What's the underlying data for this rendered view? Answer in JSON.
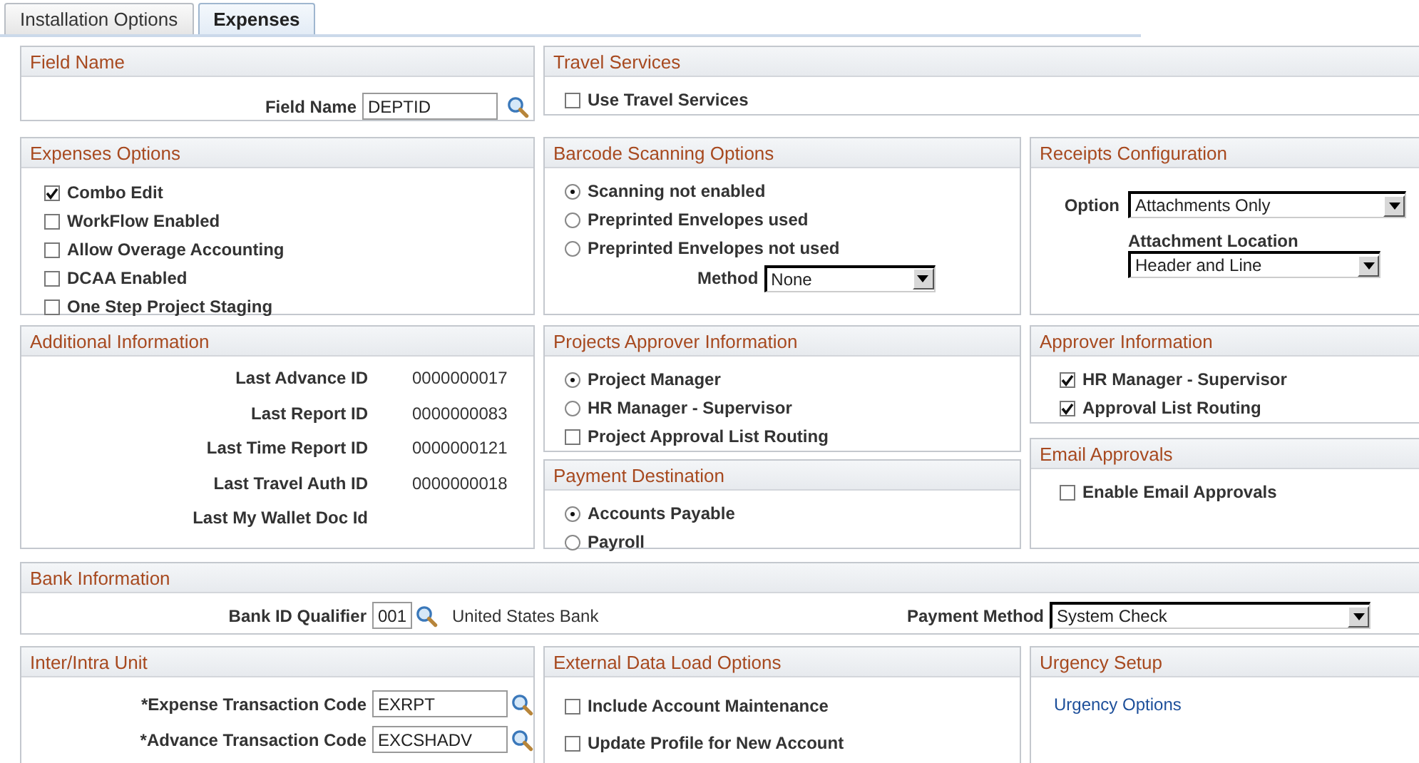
{
  "tabs": [
    {
      "label": "Installation Options",
      "selected": false
    },
    {
      "label": "Expenses",
      "selected": true
    }
  ],
  "field_name": {
    "title": "Field Name",
    "label": "Field Name",
    "value": "DEPTID"
  },
  "travel_services": {
    "title": "Travel Services",
    "options": [
      {
        "kind": "checkbox",
        "label": "Use Travel Services",
        "checked": false
      }
    ]
  },
  "expenses_options": {
    "title": "Expenses Options",
    "options": [
      {
        "kind": "checkbox",
        "label": "Combo Edit",
        "checked": true
      },
      {
        "kind": "checkbox",
        "label": "WorkFlow Enabled",
        "checked": false
      },
      {
        "kind": "checkbox",
        "label": "Allow Overage Accounting",
        "checked": false
      },
      {
        "kind": "checkbox",
        "label": "DCAA Enabled",
        "checked": false
      },
      {
        "kind": "checkbox",
        "label": "One Step Project Staging",
        "checked": false
      }
    ]
  },
  "barcode_scanning_options": {
    "title": "Barcode Scanning Options",
    "options": [
      {
        "kind": "radio",
        "label": "Scanning not enabled",
        "selected": true
      },
      {
        "kind": "radio",
        "label": "Preprinted Envelopes used",
        "selected": false
      },
      {
        "kind": "radio",
        "label": "Preprinted Envelopes not used",
        "selected": false
      }
    ],
    "method": {
      "label": "Method",
      "value": "None"
    }
  },
  "receipts_configuration": {
    "title": "Receipts Configuration",
    "option": {
      "label": "Option",
      "value": "Attachments Only"
    },
    "attachment_location": {
      "label": "Attachment Location",
      "value": "Header and Line"
    }
  },
  "additional_information": {
    "title": "Additional Information",
    "rows": [
      {
        "label": "Last Advance ID",
        "value": "0000000017"
      },
      {
        "label": "Last Report ID",
        "value": "0000000083"
      },
      {
        "label": "Last Time Report ID",
        "value": "0000000121"
      },
      {
        "label": "Last Travel Auth ID",
        "value": "0000000018"
      },
      {
        "label": "Last My Wallet Doc Id"
      }
    ]
  },
  "projects_approver_information": {
    "title": "Projects Approver Information",
    "options": [
      {
        "kind": "radio",
        "label": "Project Manager",
        "selected": true
      },
      {
        "kind": "radio",
        "label": "HR Manager - Supervisor",
        "selected": false
      },
      {
        "kind": "checkbox",
        "label": "Project Approval List Routing",
        "checked": false
      }
    ]
  },
  "payment_destination": {
    "title": "Payment Destination",
    "options": [
      {
        "kind": "radio",
        "label": "Accounts Payable",
        "selected": true
      },
      {
        "kind": "radio",
        "label": "Payroll",
        "selected": false
      }
    ]
  },
  "approver_information": {
    "title": "Approver Information",
    "options": [
      {
        "kind": "checkbox",
        "label": "HR Manager - Supervisor",
        "checked": true
      },
      {
        "kind": "checkbox",
        "label": "Approval List Routing",
        "checked": true
      }
    ]
  },
  "email_approvals": {
    "title": "Email Approvals",
    "options": [
      {
        "kind": "checkbox",
        "label": "Enable Email Approvals",
        "checked": false
      }
    ]
  },
  "bank_information": {
    "title": "Bank Information",
    "bank_id_qualifier": {
      "label": "Bank ID Qualifier",
      "value": "001"
    },
    "bank_name": "United States Bank",
    "payment_method": {
      "label": "Payment Method",
      "value": "System Check"
    }
  },
  "inter_intra_unit": {
    "title": "Inter/Intra Unit",
    "fields": [
      {
        "label": "*Expense Transaction Code",
        "value": "EXRPT"
      },
      {
        "label": "*Advance Transaction Code",
        "value": "EXCSHADV"
      }
    ]
  },
  "external_data_load_options": {
    "title": "External Data Load Options",
    "options": [
      {
        "kind": "checkbox",
        "label": "Include Account Maintenance",
        "checked": false
      },
      {
        "kind": "checkbox",
        "label": "Update Profile for New Account",
        "checked": false
      }
    ]
  },
  "urgency_setup": {
    "title": "Urgency Setup",
    "link": "Urgency Options"
  }
}
